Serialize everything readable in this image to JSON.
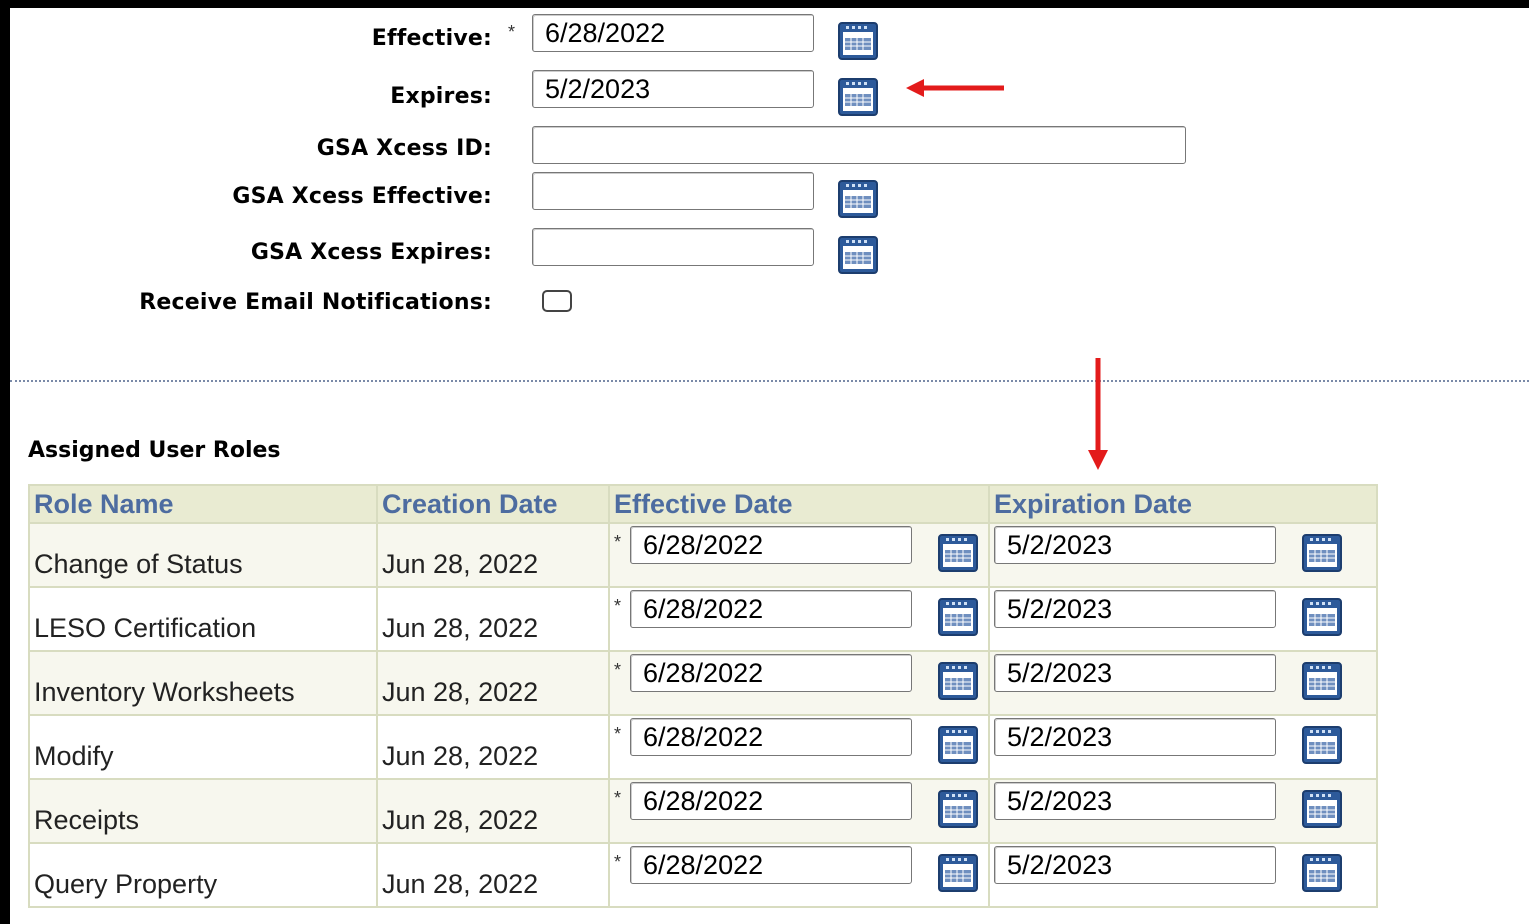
{
  "form": {
    "effective": {
      "label": "Effective:",
      "required_mark": "*",
      "value": "6/28/2022"
    },
    "expires": {
      "label": "Expires:",
      "value": "5/2/2023"
    },
    "gsa_id": {
      "label": "GSA Xcess ID:",
      "value": ""
    },
    "gsa_effective": {
      "label": "GSA Xcess Effective:",
      "value": ""
    },
    "gsa_expires": {
      "label": "GSA Xcess Expires:",
      "value": ""
    },
    "email": {
      "label": "Receive Email Notifications:",
      "checked": false
    }
  },
  "roles": {
    "title": "Assigned User Roles",
    "headers": [
      "Role Name",
      "Creation Date",
      "Effective Date",
      "Expiration Date"
    ],
    "required_mark": "*",
    "rows": [
      {
        "name": "Change of Status",
        "created": "Jun 28, 2022",
        "effective": "6/28/2022",
        "expiration": "5/2/2023"
      },
      {
        "name": "LESO Certification",
        "created": "Jun 28, 2022",
        "effective": "6/28/2022",
        "expiration": "5/2/2023"
      },
      {
        "name": "Inventory Worksheets",
        "created": "Jun 28, 2022",
        "effective": "6/28/2022",
        "expiration": "5/2/2023"
      },
      {
        "name": "Modify",
        "created": "Jun 28, 2022",
        "effective": "6/28/2022",
        "expiration": "5/2/2023"
      },
      {
        "name": "Receipts",
        "created": "Jun 28, 2022",
        "effective": "6/28/2022",
        "expiration": "5/2/2023"
      },
      {
        "name": "Query Property",
        "created": "Jun 28, 2022",
        "effective": "6/28/2022",
        "expiration": "5/2/2023"
      }
    ]
  },
  "colors": {
    "header_text": "#4d6ca0",
    "header_bg": "#e9ebd2",
    "row_alt_bg": "#f7f7ee",
    "annotation_arrow": "#e31b1b",
    "calendar_icon": "#2d5a9a"
  },
  "icons": {
    "calendar": "calendar-icon",
    "arrow": "red-arrow-annotation"
  }
}
